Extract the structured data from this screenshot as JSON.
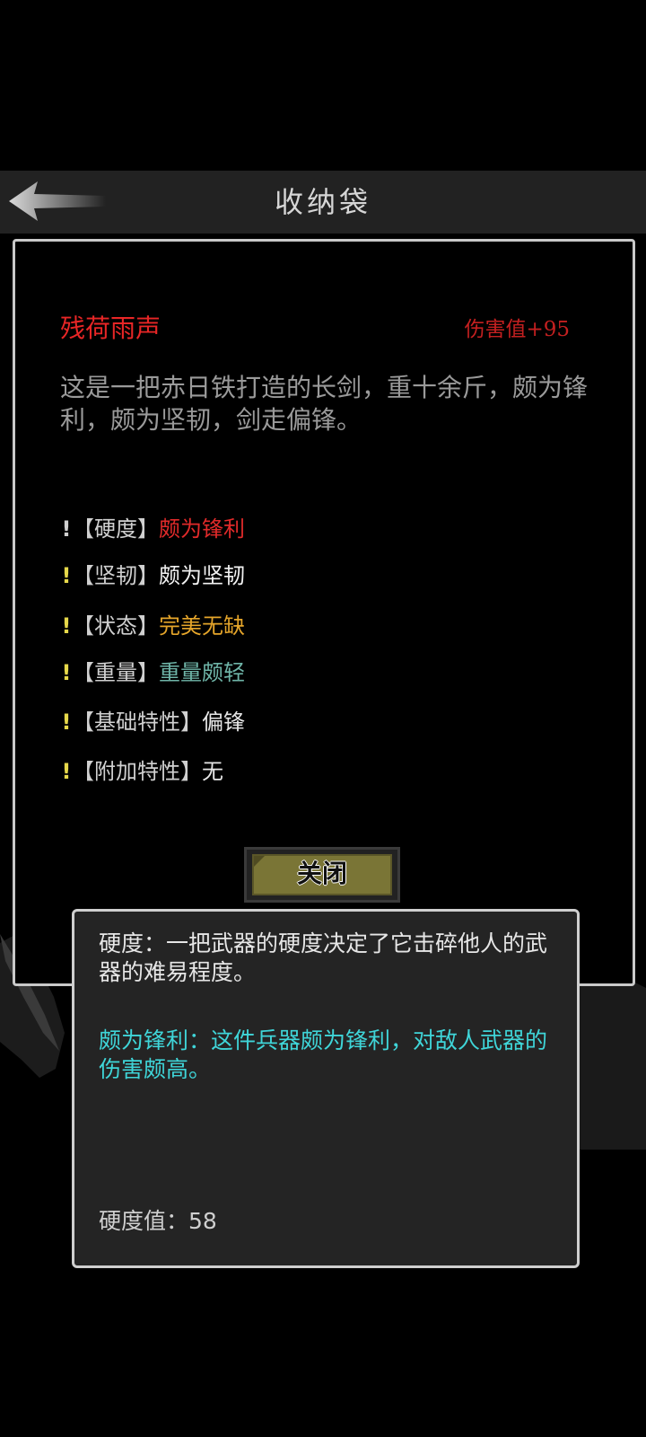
{
  "header": {
    "title": "收纳袋",
    "back_icon": "back-arrow-icon"
  },
  "item": {
    "name": "残荷雨声",
    "damage": "伤害值+95",
    "description": "这是一把赤日铁打造的长剑，重十余斤，颇为锋利，颇为坚韧，剑走偏锋。"
  },
  "attributes": [
    {
      "marker": "!",
      "label": "【硬度】",
      "value": "颇为锋利",
      "value_color": "#e02a2a",
      "marker_color": "#cfcfcf"
    },
    {
      "marker": "!",
      "label": "【坚韧】",
      "value": "颇为坚韧",
      "value_color": "#f2f2f2",
      "marker_color": "#e6d84a"
    },
    {
      "marker": "!",
      "label": "【状态】",
      "value": "完美无缺",
      "value_color": "#e5a52a",
      "marker_color": "#e6d84a"
    },
    {
      "marker": "!",
      "label": "【重量】",
      "value": "重量颇轻",
      "value_color": "#6fb5a8",
      "marker_color": "#e6d84a"
    },
    {
      "marker": "!",
      "label": "【基础特性】",
      "value": "偏锋",
      "value_color": "#e6e6e6",
      "marker_color": "#e6d84a"
    },
    {
      "marker": "!",
      "label": "【附加特性】",
      "value": "无",
      "value_color": "#e6e6e6",
      "marker_color": "#e6d84a"
    }
  ],
  "close_button": {
    "label": "关闭"
  },
  "tooltip": {
    "description": "硬度：一把武器的硬度决定了它击碎他人的武器的难易程度。",
    "effect": "颇为锋利：这件兵器颇为锋利，对敌人武器的伤害颇高。",
    "value_text": "硬度值：58"
  },
  "colors": {
    "item_name": "#e82626",
    "damage": "#c42020",
    "tooltip_effect": "#3fd5d8",
    "button_fill": "#7a7536"
  }
}
